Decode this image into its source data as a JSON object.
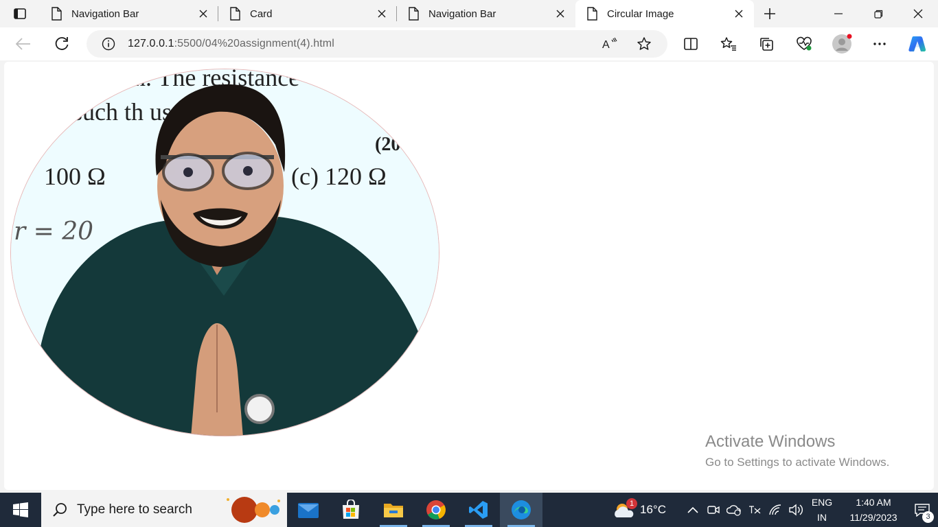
{
  "tabs": [
    {
      "label": "Navigation Bar",
      "active": false
    },
    {
      "label": "Card",
      "active": false
    },
    {
      "label": "Navigation Bar",
      "active": false
    },
    {
      "label": "Circular Image",
      "active": true
    }
  ],
  "address": {
    "host": "127.0.0.1",
    "path": ":5500/04%20assignment(4).html"
  },
  "image": {
    "board_lines": [
      "ion.  The resistance",
      "such th        used as a",
      "(20",
      "100 Ω",
      "(c)  120 Ω",
      "r = 20"
    ]
  },
  "watermark": {
    "title": "Activate Windows",
    "subtitle": "Go to Settings to activate Windows."
  },
  "taskbar": {
    "search_placeholder": "Type here to search",
    "weather": "16°C",
    "weather_badge": "1",
    "lang_top": "ENG",
    "lang_bottom": "IN",
    "time": "1:40 AM",
    "date": "11/29/2023",
    "notification_count": "3"
  },
  "colors": {
    "taskbar": "#1f2a3a",
    "tabstrip": "#f3f3f3",
    "accent": "#0078d4"
  }
}
